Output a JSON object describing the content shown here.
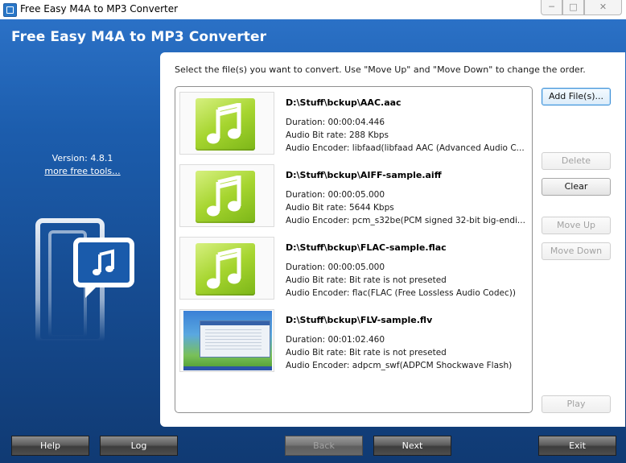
{
  "window": {
    "title": "Free Easy M4A to MP3 Converter",
    "minimize": "─",
    "maximize": "□",
    "close": "✕"
  },
  "app": {
    "title": "Free Easy M4A to MP3 Converter",
    "version": "Version: 4.8.1",
    "more_link": "more free tools..."
  },
  "instructions": "Select the file(s) you want to convert. Use \"Move Up\" and \"Move Down\" to change the order.",
  "files": [
    {
      "name": "D:\\Stuff\\bckup\\AAC.aac",
      "duration": "Duration: 00:00:04.446",
      "bitrate": "Audio Bit rate: 288 Kbps",
      "encoder": "Audio Encoder: libfaad(libfaad AAC (Advanced Audio C...",
      "thumb": "music-note-icon"
    },
    {
      "name": "D:\\Stuff\\bckup\\AIFF-sample.aiff",
      "duration": "Duration: 00:00:05.000",
      "bitrate": "Audio Bit rate: 5644 Kbps",
      "encoder": "Audio Encoder: pcm_s32be(PCM signed 32-bit big-endi...",
      "thumb": "music-note-icon"
    },
    {
      "name": "D:\\Stuff\\bckup\\FLAC-sample.flac",
      "duration": "Duration: 00:00:05.000",
      "bitrate": "Audio Bit rate: Bit rate is not preseted",
      "encoder": "Audio Encoder: flac(FLAC (Free Lossless Audio Codec))",
      "thumb": "music-note-icon"
    },
    {
      "name": "D:\\Stuff\\bckup\\FLV-sample.flv",
      "duration": "Duration: 00:01:02.460",
      "bitrate": "Audio Bit rate: Bit rate is not preseted",
      "encoder": "Audio Encoder: adpcm_swf(ADPCM Shockwave Flash)",
      "thumb": "video-screenshot"
    }
  ],
  "side_buttons": {
    "add": "Add File(s)...",
    "delete": "Delete",
    "clear": "Clear",
    "move_up": "Move Up",
    "move_down": "Move Down",
    "play": "Play"
  },
  "bottom_buttons": {
    "help": "Help",
    "log": "Log",
    "back": "Back",
    "next": "Next",
    "exit": "Exit"
  },
  "colors": {
    "accent": "#1c5dad",
    "thumb_green": "#a6d52f"
  }
}
